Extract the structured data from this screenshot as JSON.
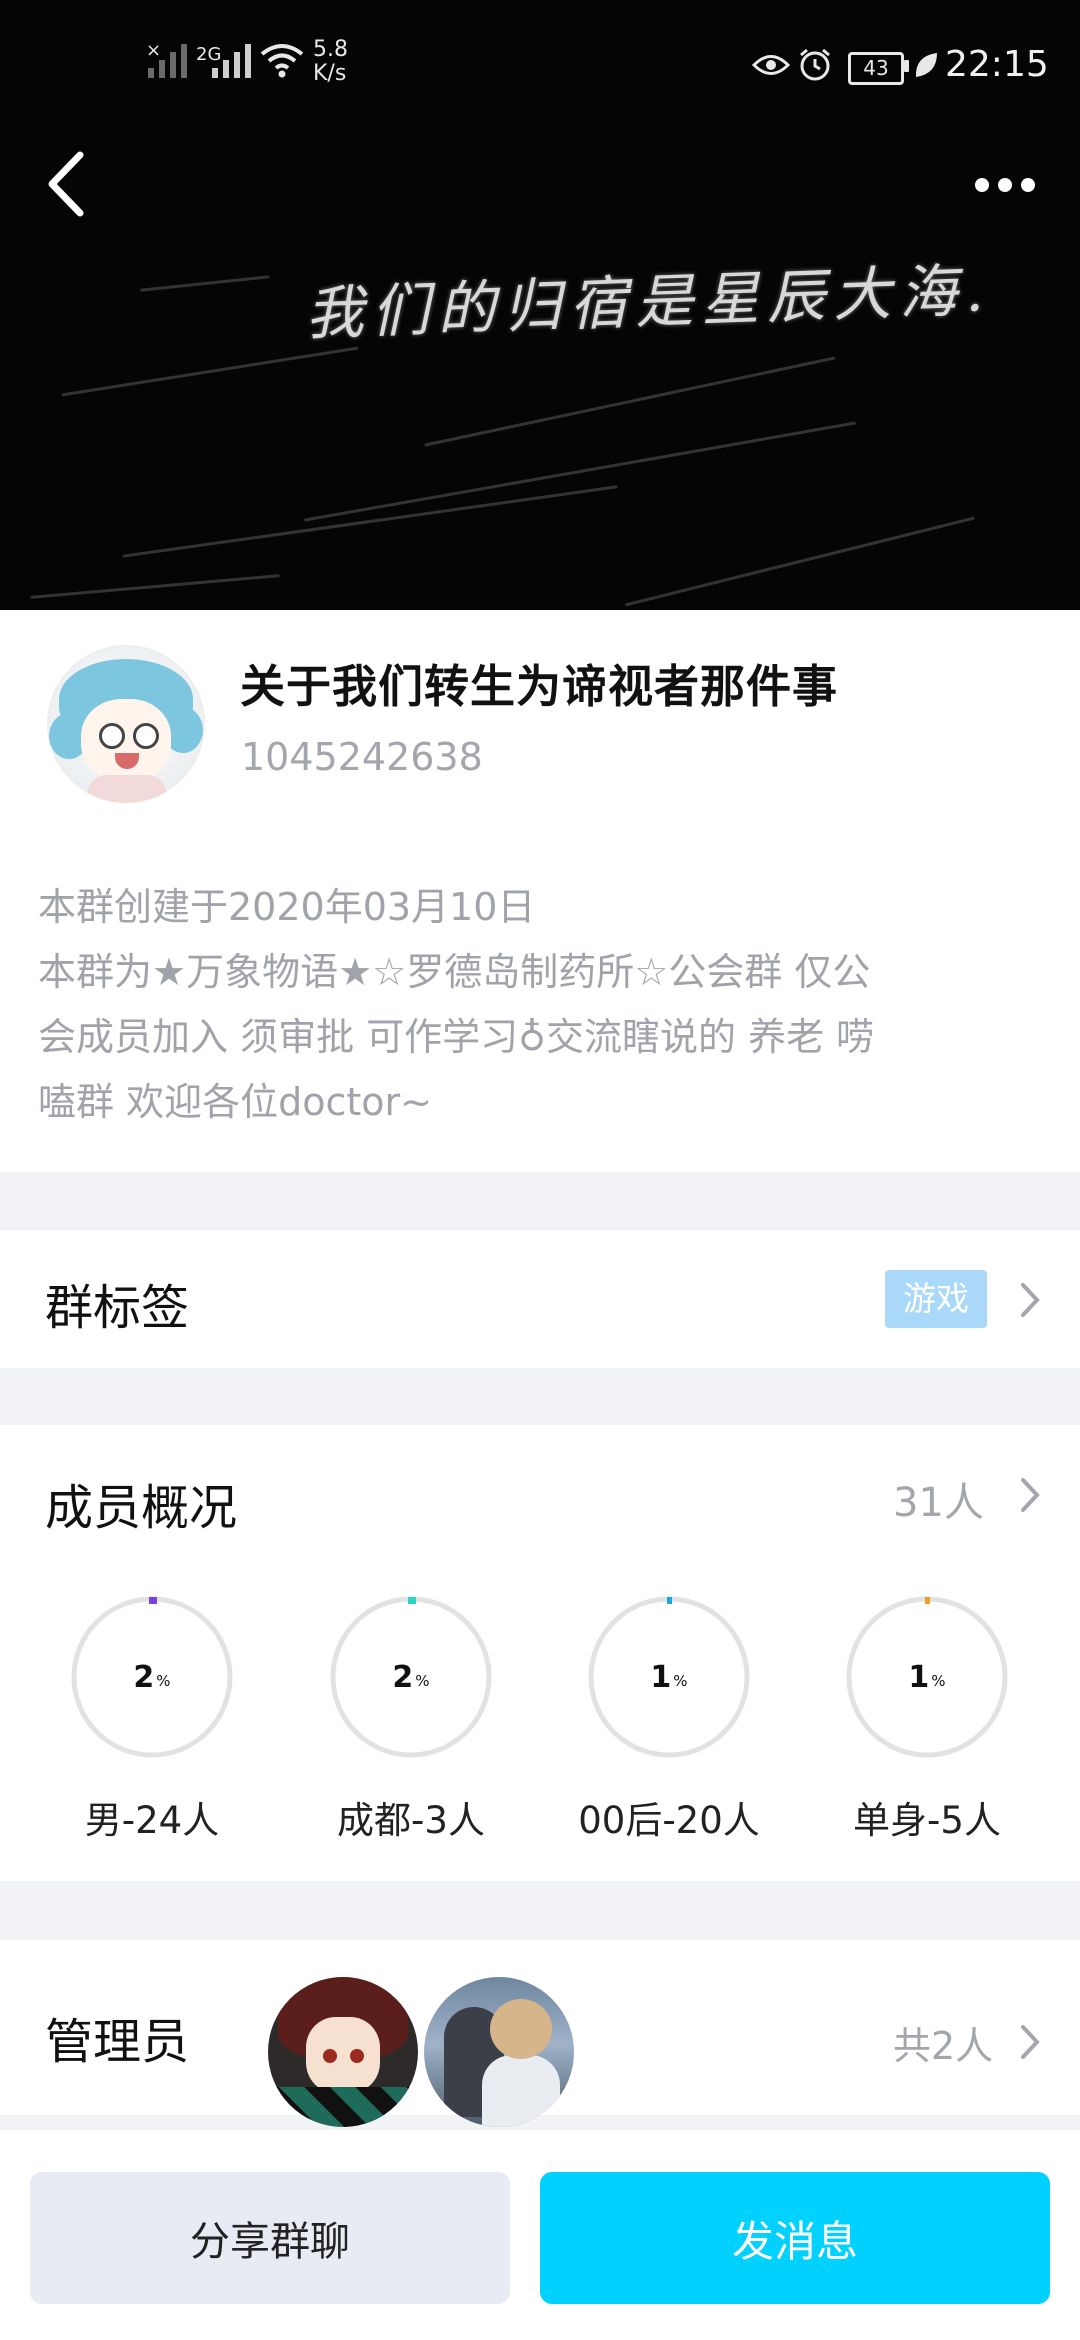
{
  "status_bar": {
    "network_1": "2G",
    "speed_value": "5.8",
    "speed_unit": "K/s",
    "battery": "43",
    "time": "22:15",
    "icons": [
      "no-signal-icon",
      "signal-icon",
      "wifi-icon",
      "eye-icon",
      "alarm-icon",
      "battery-icon",
      "leaf-icon"
    ]
  },
  "header": {
    "banner_caption": "我们的归宿是星辰大海.",
    "back_icon": "chevron-left-icon",
    "more_icon": "more-dots-icon"
  },
  "group": {
    "name": "关于我们转生为谛视者那件事",
    "id": "1045242638",
    "description_lines": [
      "本群创建于2020年03月10日",
      "本群为★万象物语★☆罗德岛制药所☆公会群 仅公",
      "会成员加入 须审批 可作学习♁交流瞎说的 养老 唠",
      "嗑群 欢迎各位doctor~"
    ]
  },
  "tags": {
    "title": "群标签",
    "tag": "游戏",
    "tag_color": "#a9d8f8"
  },
  "members": {
    "title": "成员概况",
    "count": "31人",
    "stats": [
      {
        "pct": "2",
        "unit": "%",
        "label": "男-24人",
        "color": "#7b3fe4"
      },
      {
        "pct": "2",
        "unit": "%",
        "label": "成都-3人",
        "color": "#2dd4c4"
      },
      {
        "pct": "1",
        "unit": "%",
        "label": "00后-20人",
        "color": "#1aa7d6"
      },
      {
        "pct": "1",
        "unit": "%",
        "label": "单身-5人",
        "color": "#f39c1f"
      }
    ]
  },
  "admins": {
    "title": "管理员",
    "total": "共2人"
  },
  "actions": {
    "share_label": "分享群聊",
    "send_label": "发消息",
    "send_color": "#00d1ff"
  }
}
